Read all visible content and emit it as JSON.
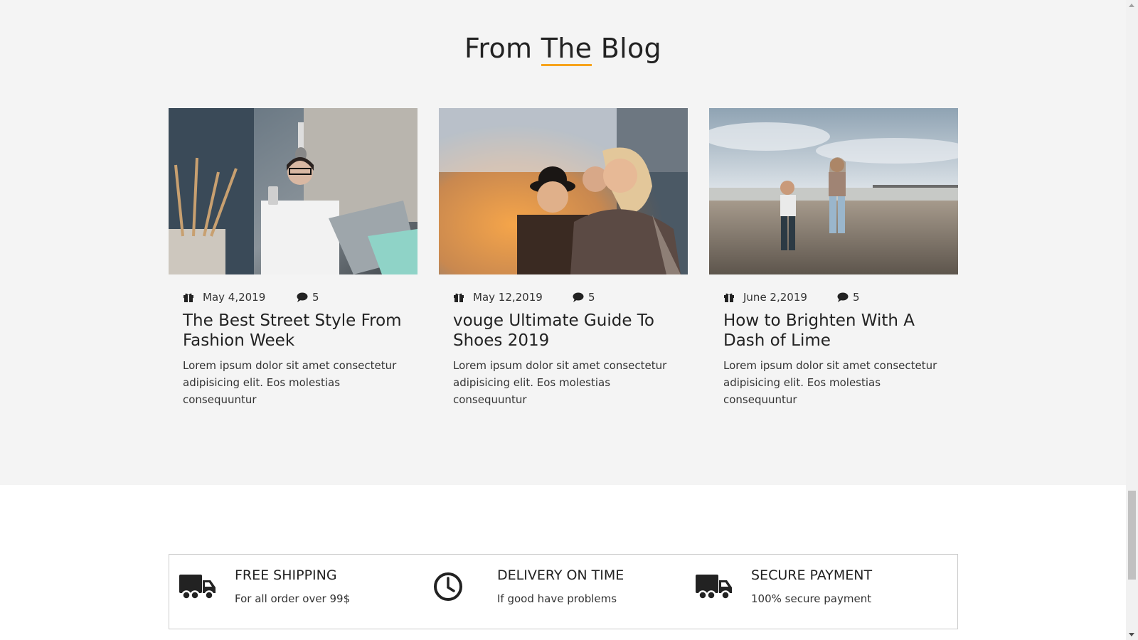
{
  "blog": {
    "title_before": "From",
    "title_highlight": "The",
    "title_after": "Blog",
    "accent_color": "#f7a31c",
    "posts": [
      {
        "image": "woman-with-laptop-and-phone-photo",
        "date_icon": "gift-icon",
        "date": "May 4,2019",
        "comment_icon": "comment-icon",
        "comments": "5",
        "title": "The Best Street Style From Fashion Week",
        "excerpt": "Lorem ipsum dolor sit amet consectetur adipisicing elit. Eos molestias consequuntur"
      },
      {
        "image": "friends-laughing-photo",
        "date_icon": "gift-icon",
        "date": "May 12,2019",
        "comment_icon": "comment-icon",
        "comments": "5",
        "title": "vouge Ultimate Guide To Shoes 2019",
        "excerpt": "Lorem ipsum dolor sit amet consectetur adipisicing elit. Eos molestias consequuntur"
      },
      {
        "image": "two-women-on-beach-photo",
        "date_icon": "gift-icon",
        "date": "June 2,2019",
        "comment_icon": "comment-icon",
        "comments": "5",
        "title": "How to Brighten With A Dash of Lime",
        "excerpt": "Lorem ipsum dolor sit amet consectetur adipisicing elit. Eos molestias consequuntur"
      }
    ]
  },
  "features": [
    {
      "icon": "truck-icon",
      "title": "FREE SHIPPING",
      "subtitle": "For all order over 99$"
    },
    {
      "icon": "clock-icon",
      "title": "DELIVERY ON TIME",
      "subtitle": "If good have problems"
    },
    {
      "icon": "truck-icon",
      "title": "SECURE PAYMENT",
      "subtitle": "100% secure payment"
    }
  ]
}
